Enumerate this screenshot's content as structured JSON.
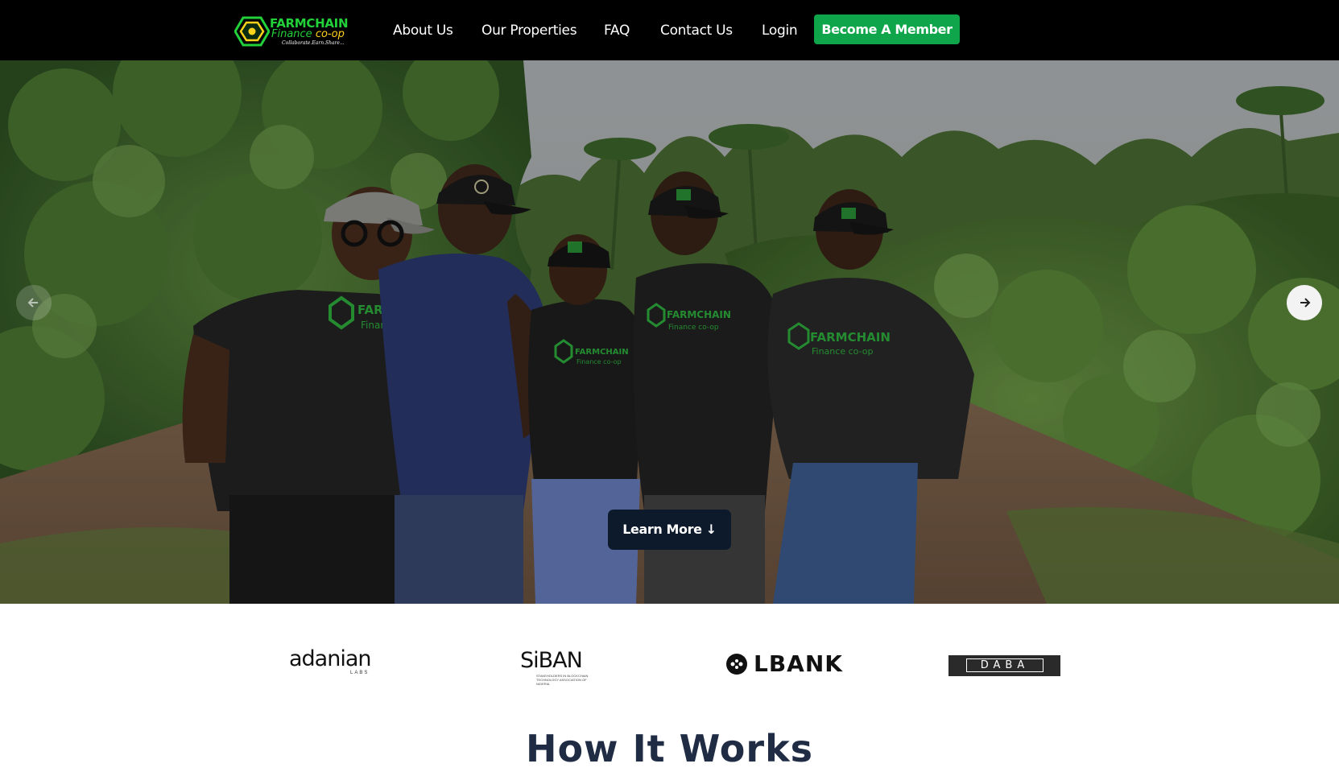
{
  "nav": {
    "logo": {
      "line1": "FARMCHAIN",
      "line2_a": "Finance",
      "line2_b": "co-op",
      "tagline": "Collaborate.Earn.Share..."
    },
    "links": [
      "About Us",
      "Our Properties",
      "FAQ",
      "Contact Us",
      "Login"
    ],
    "cta_label": "Become A Member",
    "cta_color": "#0fa54a"
  },
  "hero": {
    "learn_more_label": "Learn More",
    "learn_more_arrow": "↓",
    "prev_icon": "arrow-left-icon",
    "next_icon": "arrow-right-icon",
    "shirt_text": {
      "line1": "FARMCHAIN",
      "line2": "Finance co-op",
      "line3": "Collaborate.Earn.Share..."
    }
  },
  "partners": {
    "adanian": {
      "name": "adanian",
      "sub": "LABS"
    },
    "siban": {
      "name": "SiBAN",
      "sub": "STAKEHOLDERS IN BLOCKCHAIN TECHNOLOGY ASSOCIATION OF NIGERIA"
    },
    "lbank": {
      "name": "LBANK"
    },
    "daba": {
      "name": "DABA"
    }
  },
  "section": {
    "how_title": "How It Works",
    "title_color": "#1f2c44"
  }
}
